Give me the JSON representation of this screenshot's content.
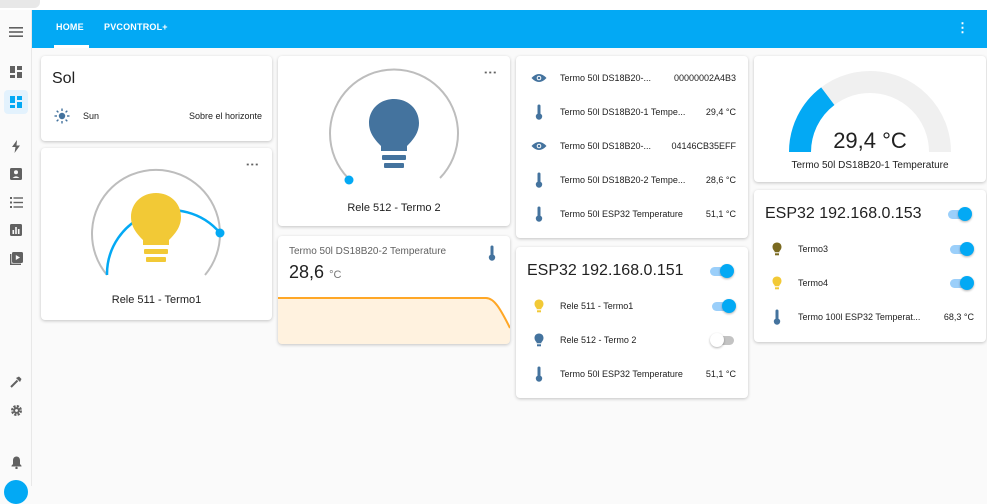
{
  "nav": {
    "tabs": [
      {
        "label": "HOME"
      },
      {
        "label": "PVCONTROL+"
      }
    ]
  },
  "sidebar": {
    "icons": [
      "menu-icon",
      "dashboard-icon",
      "dashboard-active-icon",
      "energy-icon",
      "logbook-icon",
      "list-icon",
      "history-icon",
      "media-icon",
      "developer-tools-icon",
      "settings-icon",
      "notifications-icon"
    ]
  },
  "sol_card": {
    "title": "Sol",
    "entity": "Sun",
    "state": "Sobre el horizonte"
  },
  "rele511": {
    "name": "Rele 511 - Termo1",
    "color": "#f2c936",
    "ring": "#03a9f4"
  },
  "rele512": {
    "name": "Rele 512 - Termo 2",
    "color": "#44739e",
    "ring": "#bdbdbd"
  },
  "sensor_card": {
    "name": "Termo 50l DS18B20-2 Temperature",
    "value": "28,6",
    "unit": "°C",
    "graph_color": "#ffa726"
  },
  "entities_card": {
    "rows": [
      {
        "icon": "eye-icon",
        "name": "Termo 50l DS18B20-... ",
        "value": "00000002A4B3"
      },
      {
        "icon": "thermometer-icon",
        "name": "Termo 50l DS18B20-1 Tempe...",
        "value": "29,4 °C"
      },
      {
        "icon": "eye-icon",
        "name": "Termo 50l DS18B20-... ",
        "value": "04146CB35EFF"
      },
      {
        "icon": "thermometer-icon",
        "name": "Termo 50l DS18B20-2 Tempe...",
        "value": "28,6 °C"
      },
      {
        "icon": "thermometer-icon",
        "name": "Termo 50l ESP32 Temperature",
        "value": "51,1 °C"
      }
    ]
  },
  "esp151": {
    "title": "ESP32 192.168.0.151",
    "rows": [
      {
        "icon": "bulb-icon",
        "name": "Rele 511 - Termo1",
        "value": ""
      },
      {
        "icon": "bulb-icon",
        "name": "Rele 512 - Termo 2",
        "value": ""
      },
      {
        "icon": "thermometer-icon",
        "name": "Termo 50l ESP32 Temperature",
        "value": "51,1 °C"
      }
    ],
    "toggles": {
      "rele511": 1,
      "rele512": 0,
      "header": 1
    }
  },
  "gauge": {
    "value_text": "29,4 °C",
    "name": "Termo 50l DS18B20-1 Temperature",
    "level": 0.294,
    "color": "#03a9f4"
  },
  "esp153": {
    "title": "ESP32 192.168.0.153",
    "rows": [
      {
        "icon": "bulb-icon",
        "name": "Termo3",
        "value": ""
      },
      {
        "icon": "bulb-icon",
        "name": "Termo4",
        "value": ""
      },
      {
        "icon": "thermometer-icon",
        "name": "Termo 100l ESP32 Temperat...",
        "value": "68,3 °C"
      }
    ],
    "toggles": {
      "header": 1,
      "termo3": 1,
      "termo4": 1
    }
  }
}
